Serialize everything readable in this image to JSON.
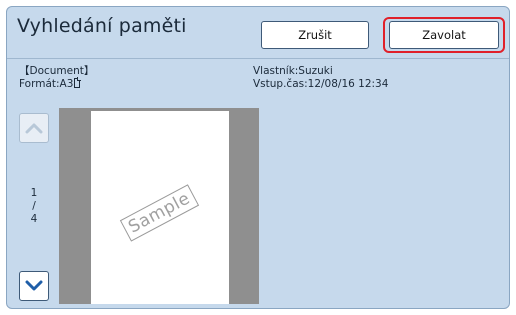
{
  "header": {
    "title": "Vyhledání paměti",
    "cancel_label": "Zrušit",
    "call_label": "Zavolat"
  },
  "document_info": {
    "name": "【Document】",
    "format": "Formát:A3",
    "owner": "Vlastník:Suzuki",
    "input_time": "Vstup.čas:12/08/16 12:34"
  },
  "pager": {
    "current": "1",
    "separator": "/",
    "total": "4"
  },
  "preview": {
    "watermark": "Sample"
  },
  "colors": {
    "panel_bg": "#c6d9ec",
    "highlight": "#e0202a",
    "accent": "#1f5ea8"
  },
  "icons": {
    "up": "chevron-up-icon",
    "down": "chevron-down-icon",
    "format": "portrait-page-icon"
  }
}
